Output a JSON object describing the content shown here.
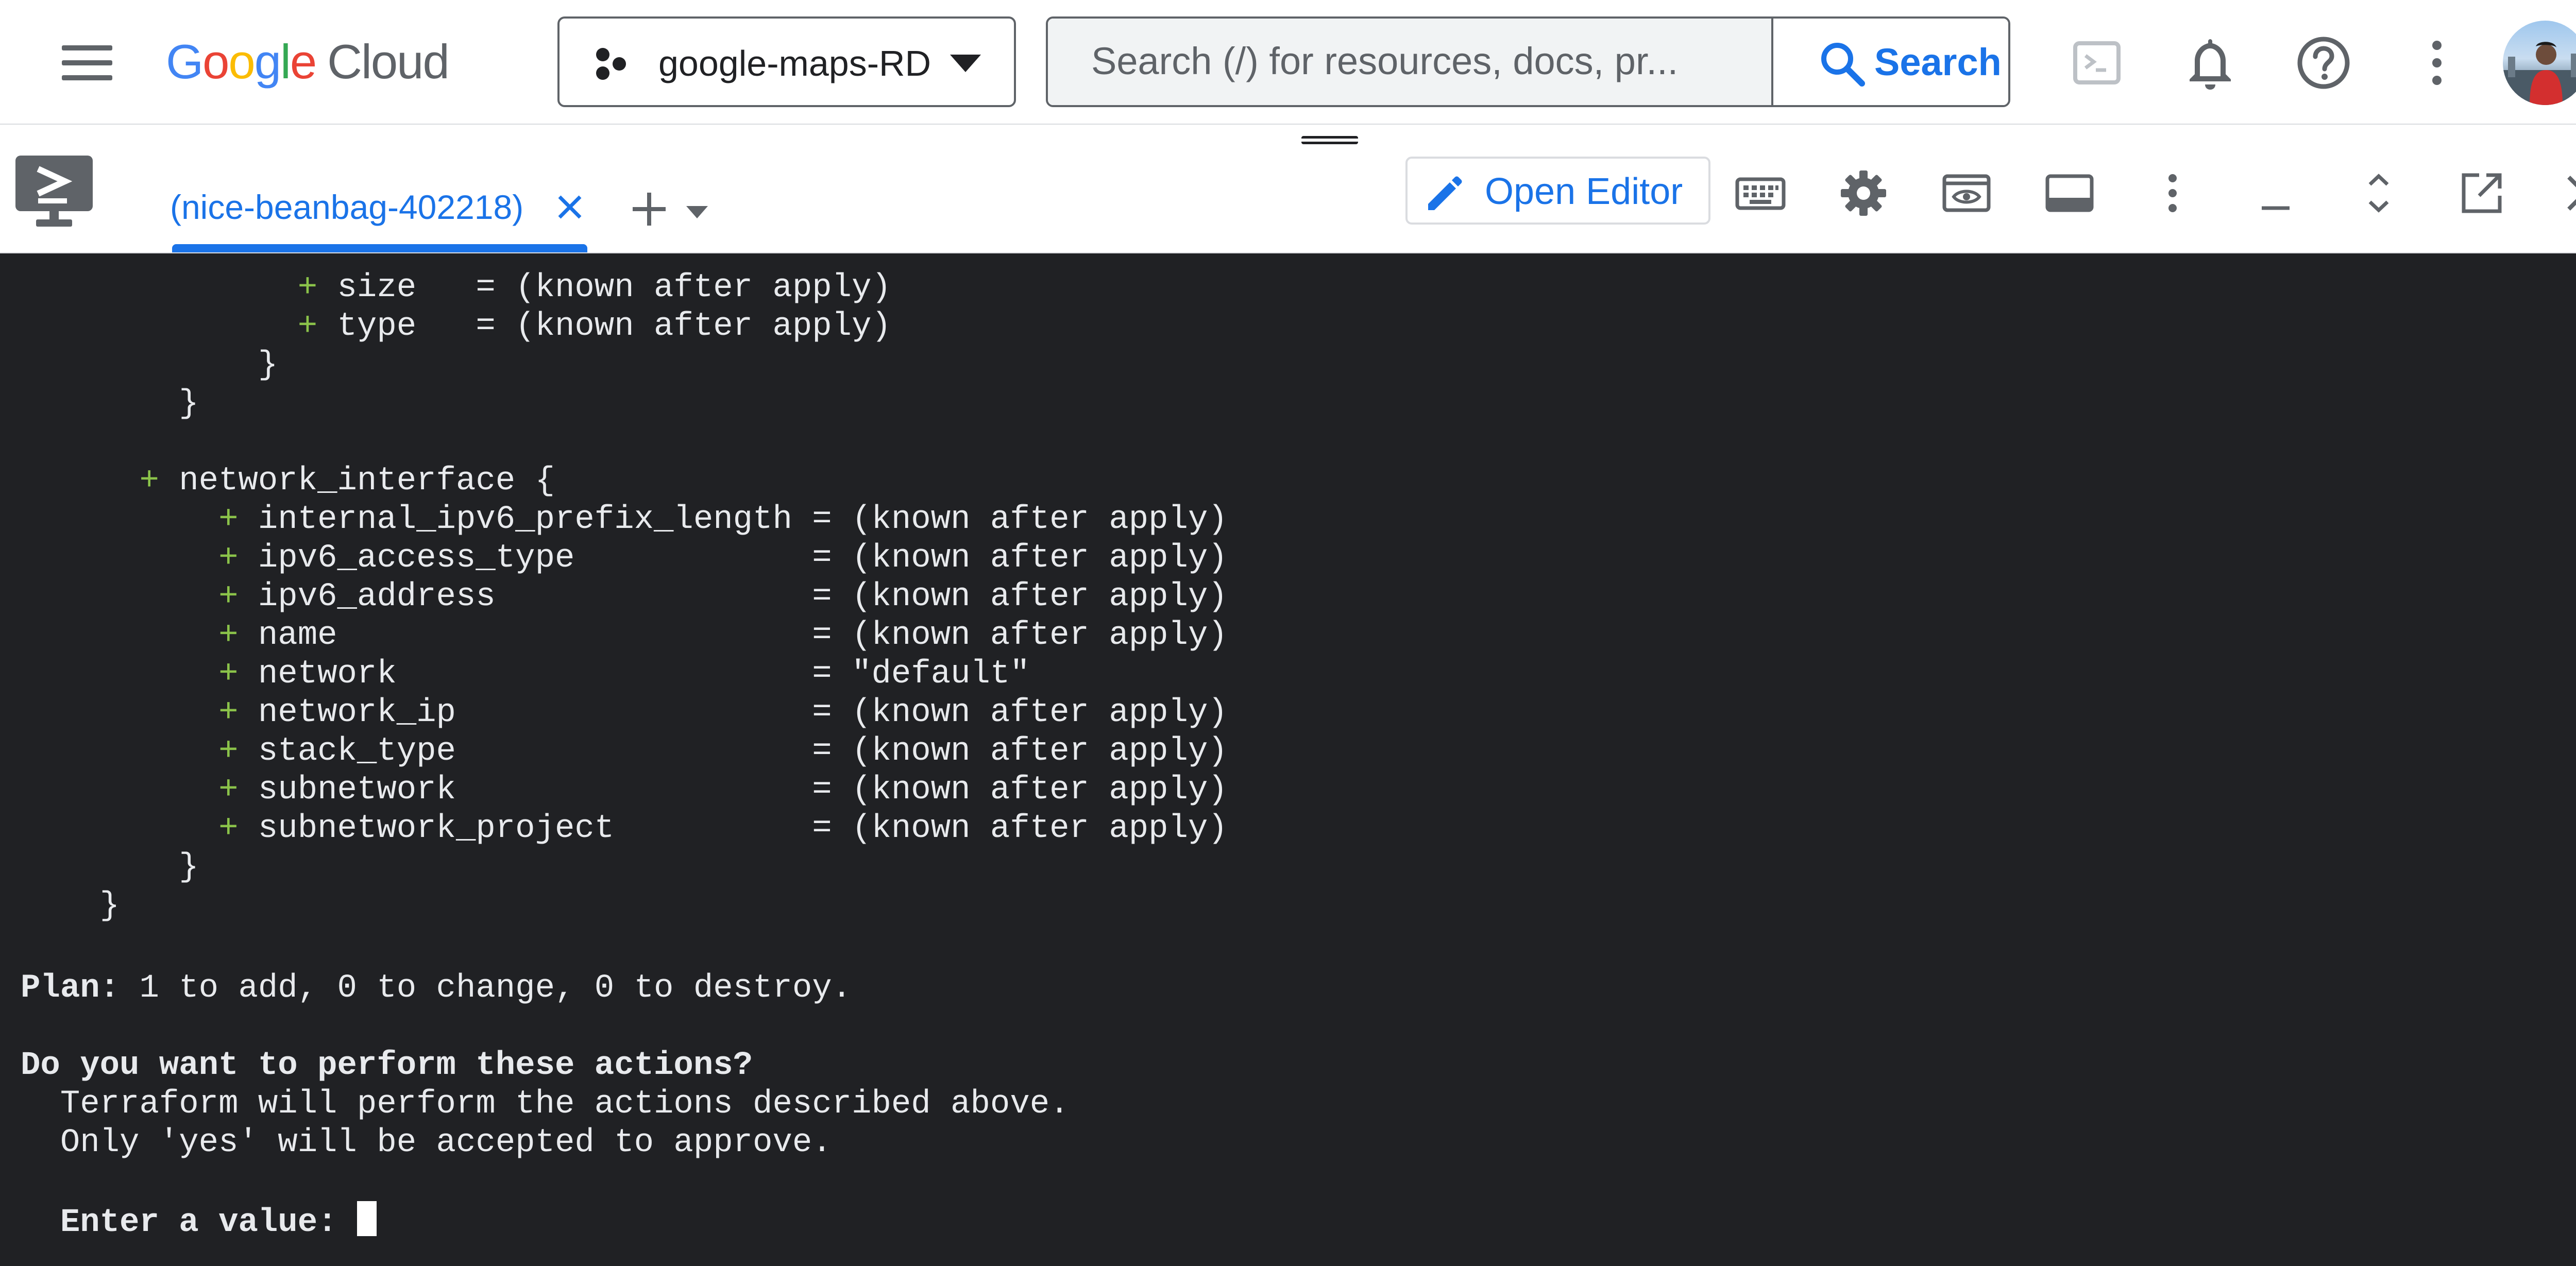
{
  "topbar": {
    "brand_google": [
      "G",
      "o",
      "o",
      "g",
      "l",
      "e"
    ],
    "brand_cloud": "Cloud",
    "project_name": "google-maps-RD",
    "search_placeholder": "Search (/) for resources, docs, pr...",
    "search_button": "Search"
  },
  "shell": {
    "tab_label": "(nice-beanbag-402218)",
    "open_editor_label": "Open Editor"
  },
  "terminal": {
    "lines": [
      {
        "indent": "              ",
        "plus": true,
        "text": "size   = (known after apply)"
      },
      {
        "indent": "              ",
        "plus": true,
        "text": "type   = (known after apply)"
      },
      {
        "indent": "            ",
        "plus": false,
        "text": "}"
      },
      {
        "indent": "        ",
        "plus": false,
        "text": "}"
      },
      {
        "indent": "",
        "plus": false,
        "text": ""
      },
      {
        "indent": "      ",
        "plus": true,
        "text": "network_interface {"
      },
      {
        "indent": "          ",
        "plus": true,
        "text": "internal_ipv6_prefix_length = (known after apply)"
      },
      {
        "indent": "          ",
        "plus": true,
        "text": "ipv6_access_type            = (known after apply)"
      },
      {
        "indent": "          ",
        "plus": true,
        "text": "ipv6_address                = (known after apply)"
      },
      {
        "indent": "          ",
        "plus": true,
        "text": "name                        = (known after apply)"
      },
      {
        "indent": "          ",
        "plus": true,
        "text": "network                     = \"default\""
      },
      {
        "indent": "          ",
        "plus": true,
        "text": "network_ip                  = (known after apply)"
      },
      {
        "indent": "          ",
        "plus": true,
        "text": "stack_type                  = (known after apply)"
      },
      {
        "indent": "          ",
        "plus": true,
        "text": "subnetwork                  = (known after apply)"
      },
      {
        "indent": "          ",
        "plus": true,
        "text": "subnetwork_project          = (known after apply)"
      },
      {
        "indent": "        ",
        "plus": false,
        "text": "}"
      },
      {
        "indent": "    ",
        "plus": false,
        "text": "}"
      }
    ],
    "plan_label": "Plan:",
    "plan_text": " 1 to add, 0 to change, 0 to destroy.",
    "question": "Do you want to perform these actions?",
    "desc1": "  Terraform will perform the actions described above.",
    "desc2": "  Only 'yes' will be accepted to approve.",
    "prompt": "  Enter a value: "
  }
}
